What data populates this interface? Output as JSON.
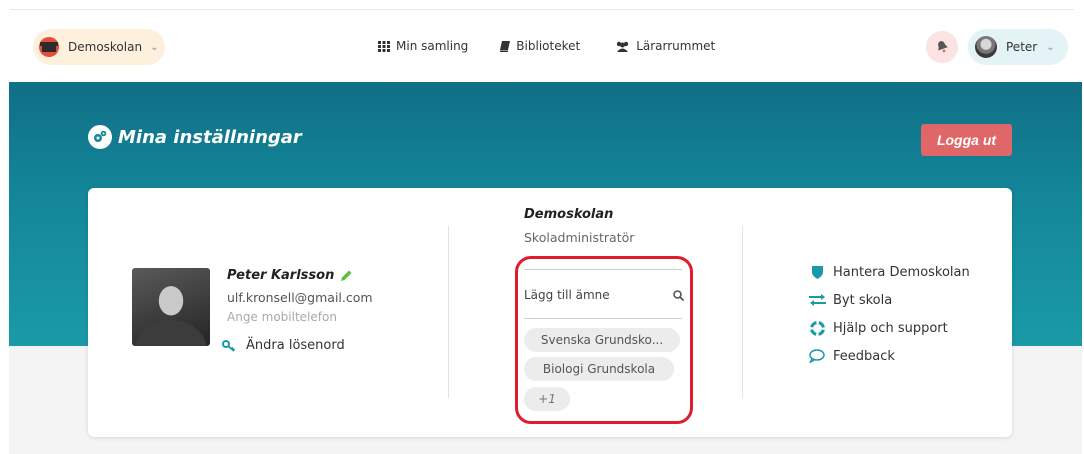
{
  "topnav": {
    "school_label": "Demoskolan",
    "links": [
      {
        "label": "Min samling",
        "icon": "grid-icon"
      },
      {
        "label": "Biblioteket",
        "icon": "book-icon"
      },
      {
        "label": "Lärarrummet",
        "icon": "users-icon"
      }
    ],
    "user_label": "Peter"
  },
  "header": {
    "title": "Mina inställningar",
    "logout_label": "Logga ut"
  },
  "profile": {
    "name": "Peter Karlsson",
    "email": "ulf.kronsell@gmail.com",
    "phone_prompt": "Ange mobiltelefon",
    "change_password_label": "Ändra lösenord"
  },
  "school": {
    "name": "Demoskolan",
    "role": "Skoladministratör",
    "subject_placeholder": "Lägg till ämne",
    "subjects": [
      "Svenska Grundsko...",
      "Biologi Grundskola"
    ],
    "more_label": "+1"
  },
  "actions": [
    {
      "label": "Hantera Demoskolan",
      "icon": "shield-icon"
    },
    {
      "label": "Byt skola",
      "icon": "swap-arrows-icon"
    },
    {
      "label": "Hjälp och support",
      "icon": "lifebuoy-icon"
    },
    {
      "label": "Feedback",
      "icon": "speech-bubble-icon"
    }
  ],
  "colors": {
    "hero": "#14879a",
    "accent": "#1a9aa6",
    "logout": "#e06767",
    "highlight": "#e01c2a"
  }
}
